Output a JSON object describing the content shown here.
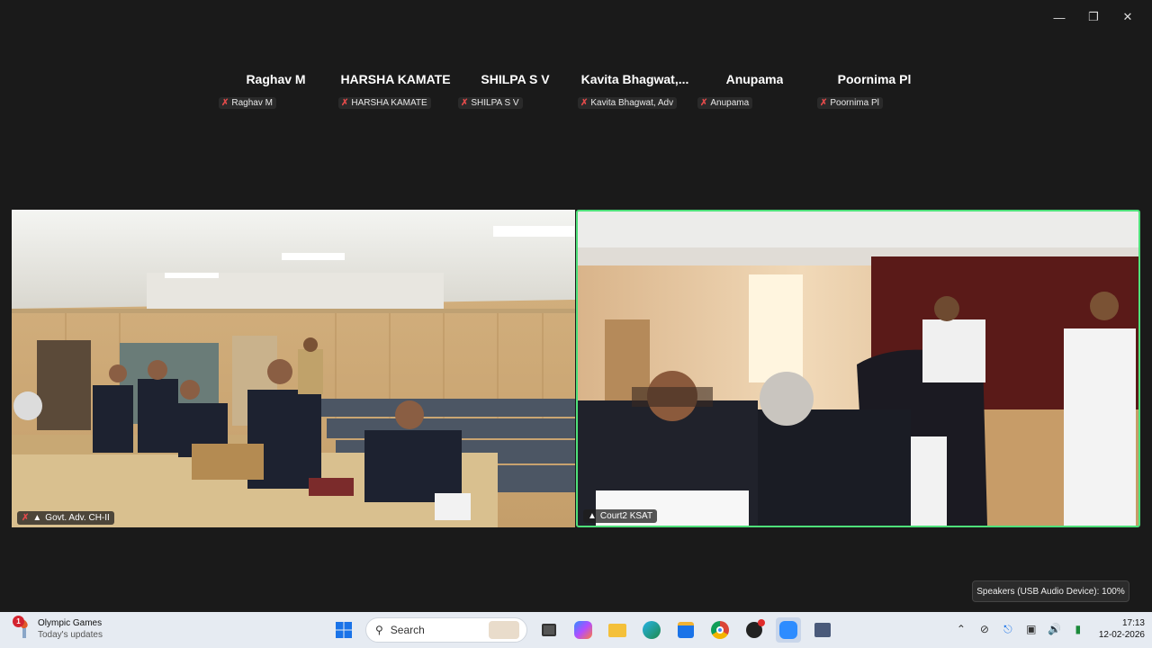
{
  "window": {
    "minimize_icon": "minimize-icon",
    "restore_icon": "restore-icon",
    "close_icon": "close-icon"
  },
  "participants": [
    {
      "display": "Raghav M",
      "tag": "Raghav M"
    },
    {
      "display": "HARSHA KAMATE",
      "tag": "HARSHA KAMATE"
    },
    {
      "display": "SHILPA S V",
      "tag": "SHILPA S V"
    },
    {
      "display": "Kavita  Bhagwat,...",
      "tag": "Kavita Bhagwat, Adv"
    },
    {
      "display": "Anupama",
      "tag": "Anupama"
    },
    {
      "display": "Poornima Pl",
      "tag": "Poornima Pl"
    }
  ],
  "videos": {
    "left": {
      "label": "Govt. Adv. CH-II"
    },
    "right": {
      "label": "Court2 KSAT",
      "active_speaker_color": "#4ee07a"
    }
  },
  "tooltip": {
    "text": "Speakers (USB Audio Device): 100%"
  },
  "taskbar": {
    "widget": {
      "title": "Olympic Games",
      "subtitle": "Today's updates",
      "badge": "1"
    },
    "search_placeholder": "Search",
    "apps": [
      "start-icon",
      "search-icon",
      "task-view-icon",
      "copilot-icon",
      "file-explorer-icon",
      "edge-icon",
      "store-icon",
      "chrome-icon",
      "media-icon",
      "zoom-icon",
      "network-tool-icon"
    ],
    "tray": [
      "chevron-up-icon",
      "network-off-icon",
      "microphone-icon",
      "display-icon",
      "volume-icon",
      "battery-icon"
    ],
    "time": "17:13",
    "date": "12-02-2026"
  }
}
